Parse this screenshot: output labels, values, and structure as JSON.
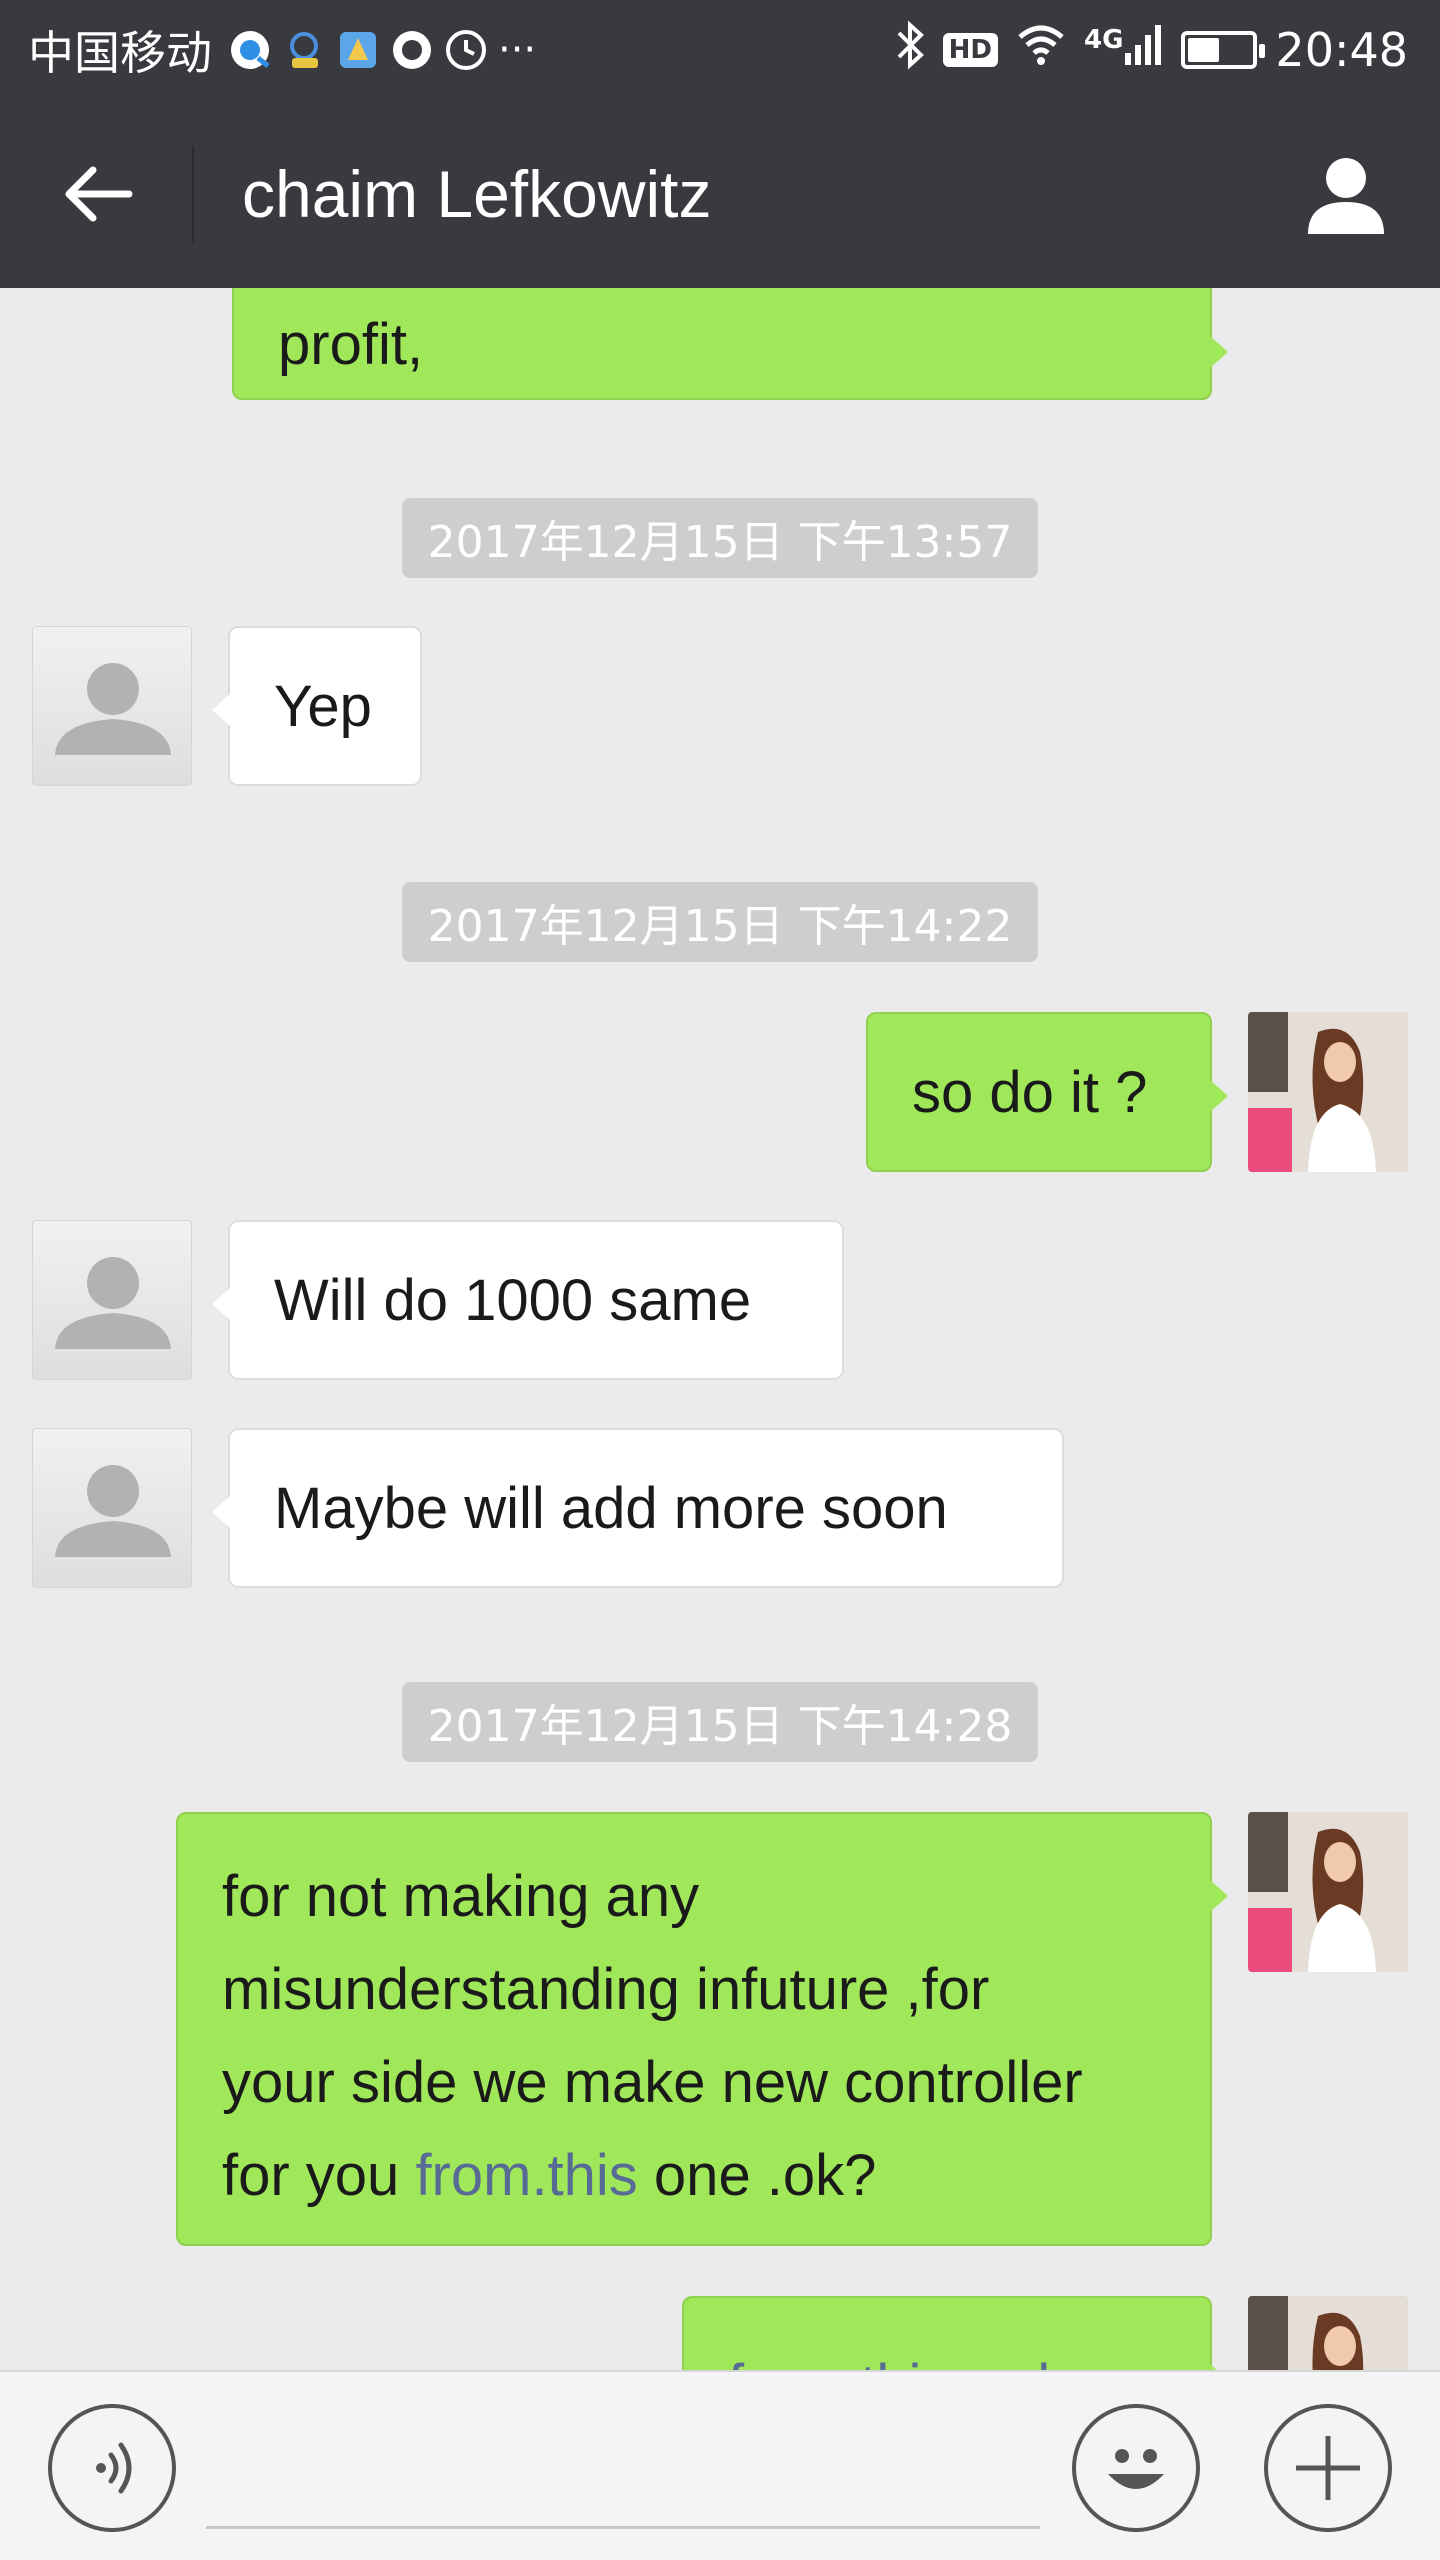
{
  "status_bar": {
    "carrier": "中国移动",
    "more": "···",
    "network": "4G",
    "hd": "HD",
    "time": "20:48",
    "battery_level": 0.45
  },
  "header": {
    "title": "chaim Lefkowitz"
  },
  "messages": [
    {
      "side": "out",
      "text": "profit,"
    },
    {
      "side": "timestamp",
      "text": "2017年12月15日 下午13:57"
    },
    {
      "side": "in",
      "text": "Yep"
    },
    {
      "side": "timestamp",
      "text": "2017年12月15日 下午14:22"
    },
    {
      "side": "out",
      "text": "so do it ?"
    },
    {
      "side": "in",
      "text": "Will do 1000 same"
    },
    {
      "side": "in",
      "text": "Maybe will add more soon"
    },
    {
      "side": "timestamp",
      "text": "2017年12月15日 下午14:28"
    },
    {
      "side": "out",
      "text_lines": [
        "for not making any",
        "misunderstanding infuture ,for",
        "your side we make new controller"
      ],
      "last_line_before": "for you ",
      "link": "from.this",
      "last_line_after": " one .ok?"
    },
    {
      "side": "out",
      "text": "from.this order"
    }
  ],
  "colors": {
    "bar_bg": "#393a3f",
    "chat_bg": "#ebebeb",
    "outgoing_bubble": "#a0e75a",
    "incoming_bubble": "#ffffff",
    "link": "#576b95",
    "timestamp_bg": "#cecece"
  },
  "icons": {
    "back": "arrow-left-icon",
    "profile": "person-icon",
    "voice": "voice-icon",
    "emoji": "smiley-icon",
    "more": "plus-icon"
  }
}
